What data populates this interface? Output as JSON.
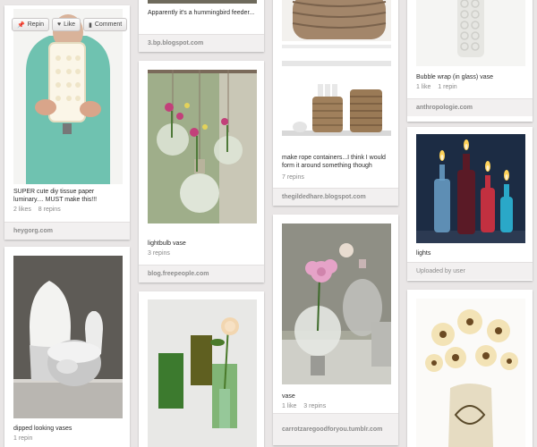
{
  "actions": {
    "repin": "Repin",
    "like": "Like",
    "comment": "Comment"
  },
  "pins": [
    {
      "id": "luminary",
      "description": "SUPER cute diy tissue paper luminary.... MUST make this!!!",
      "likes": "2 likes",
      "repins": "8 repins",
      "source": "heygorg.com"
    },
    {
      "id": "white-vases",
      "description": "dipped looking vases",
      "repins": "1 repin"
    },
    {
      "id": "hummingbird",
      "description": "Apparently it's a hummingbird feeder...",
      "source": "3.bp.blogspot.com"
    },
    {
      "id": "lightbulb",
      "description": "lightbulb vase",
      "repins": "3 repins",
      "source": "blog.freepeople.com"
    },
    {
      "id": "green-bottles"
    },
    {
      "id": "rope",
      "description": "make rope containers...I think I would form it around something though",
      "repins": "7 repins",
      "source": "thegildedhare.blogspot.com"
    },
    {
      "id": "vase",
      "description": "vase",
      "likes": "1 like",
      "repins": "3 repins",
      "source": "carrotzaregoodforyou.tumblr.com"
    },
    {
      "id": "bubble-wrap",
      "description": "Bubble wrap (in glass) vase",
      "likes": "1 like",
      "repins": "1 repin",
      "source": "anthropologie.com"
    },
    {
      "id": "lights",
      "description": "lights",
      "source": "Uploaded by user"
    },
    {
      "id": "daisies"
    }
  ]
}
